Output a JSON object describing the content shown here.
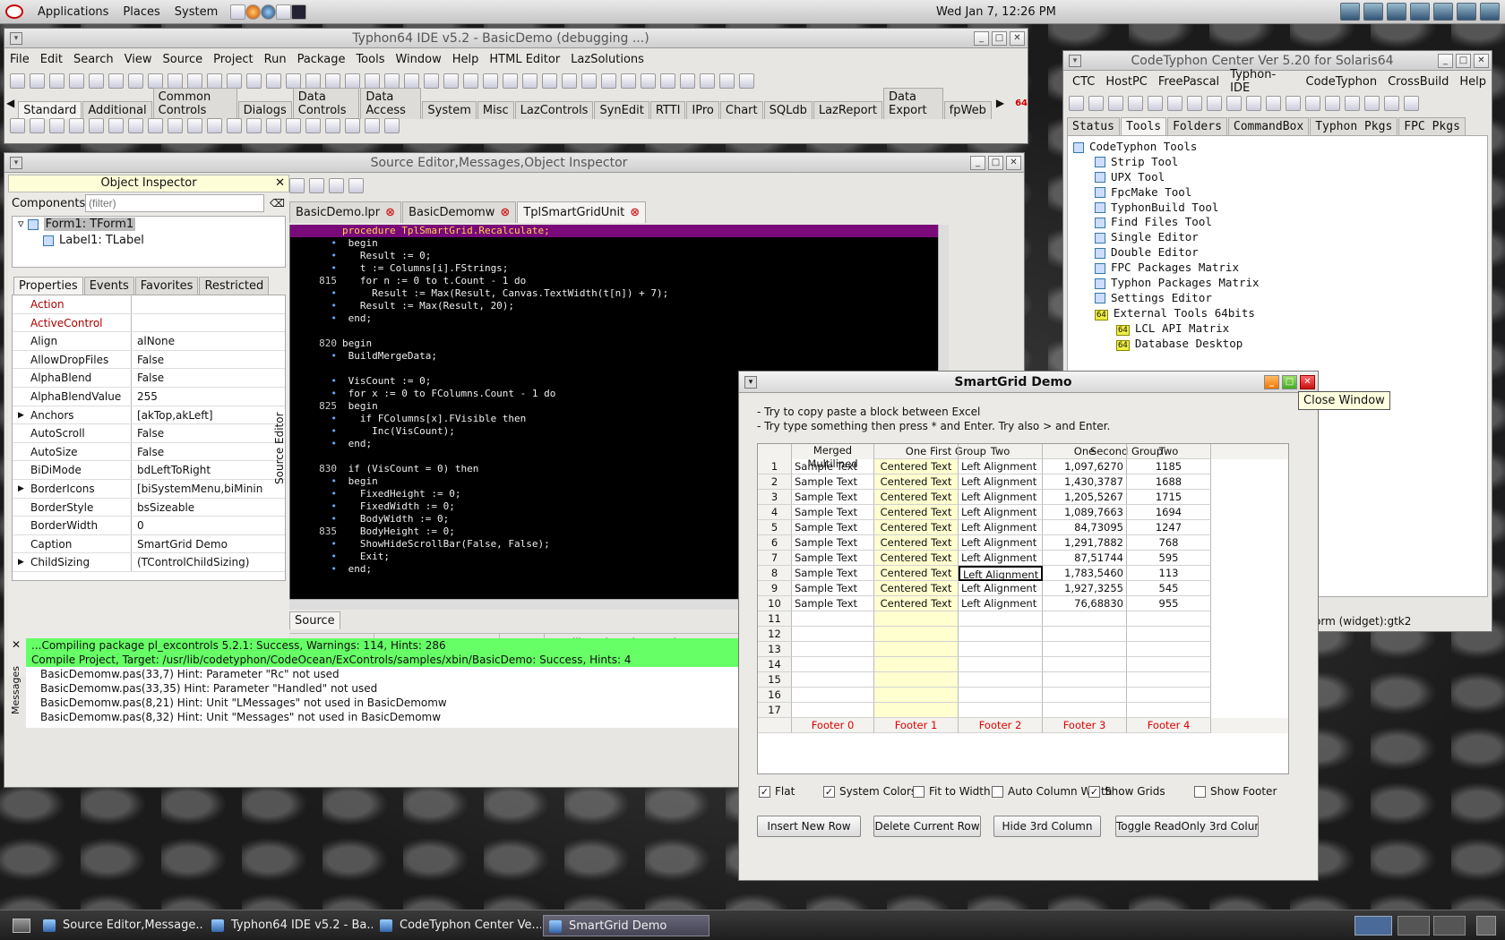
{
  "topbar": {
    "menus": [
      "Applications",
      "Places",
      "System"
    ],
    "clock": "Wed Jan  7, 12:26 PM"
  },
  "ide": {
    "title": "Typhon64 IDE v5.2 - BasicDemo (debugging ...)",
    "menus": [
      "File",
      "Edit",
      "Search",
      "View",
      "Source",
      "Project",
      "Run",
      "Package",
      "Tools",
      "Window",
      "Help",
      "HTML Editor",
      "LazSolutions"
    ],
    "palette_tabs": [
      "Standard",
      "Additional",
      "Common Controls",
      "Dialogs",
      "Data Controls",
      "Data Access",
      "System",
      "Misc",
      "LazControls",
      "SynEdit",
      "RTTI",
      "IPro",
      "Chart",
      "SQLdb",
      "LazReport",
      "Data Export",
      "fpWeb"
    ],
    "badge": "64"
  },
  "source_window": {
    "title": "Source Editor,Messages,Object Inspector"
  },
  "object_inspector": {
    "title": "Object Inspector",
    "components_label": "Components",
    "filter_placeholder": "(filter)",
    "tree": [
      "Form1: TForm1",
      "Label1: TLabel"
    ],
    "tabs": [
      "Properties",
      "Events",
      "Favorites",
      "Restricted"
    ],
    "props": [
      {
        "k": "Action",
        "v": "",
        "red": true
      },
      {
        "k": "ActiveControl",
        "v": "",
        "red": true
      },
      {
        "k": "Align",
        "v": "alNone"
      },
      {
        "k": "AllowDropFiles",
        "v": "False"
      },
      {
        "k": "AlphaBlend",
        "v": "False"
      },
      {
        "k": "AlphaBlendValue",
        "v": "255"
      },
      {
        "k": "Anchors",
        "v": "[akTop,akLeft]",
        "exp": true
      },
      {
        "k": "AutoScroll",
        "v": "False"
      },
      {
        "k": "AutoSize",
        "v": "False"
      },
      {
        "k": "BiDiMode",
        "v": "bdLeftToRight"
      },
      {
        "k": "BorderIcons",
        "v": "[biSystemMenu,biMinin",
        "exp": true
      },
      {
        "k": "BorderStyle",
        "v": "bsSizeable"
      },
      {
        "k": "BorderWidth",
        "v": "0"
      },
      {
        "k": "Caption",
        "v": "SmartGrid Demo"
      },
      {
        "k": "ChildSizing",
        "v": "(TControlChildSizing)",
        "exp": true
      }
    ]
  },
  "editor": {
    "side_label": "Source Editor",
    "tabs": [
      "BasicDemo.lpr",
      "BasicDemomw",
      "TplSmartGridUnit"
    ],
    "lines": [
      {
        "g": "",
        "t": "procedure TplSmartGrid.Recalculate;",
        "hl": true
      },
      {
        "g": "•",
        "t": " begin"
      },
      {
        "g": "•",
        "t": "   Result := 0;"
      },
      {
        "g": "•",
        "t": "   t := Columns[i].FStrings;"
      },
      {
        "g": "815",
        "t": "   for n := 0 to t.Count - 1 do"
      },
      {
        "g": "•",
        "t": "     Result := Max(Result, Canvas.TextWidth(t[n]) + 7);"
      },
      {
        "g": "•",
        "t": "   Result := Max(Result, 20);"
      },
      {
        "g": "•",
        "t": " end;"
      },
      {
        "g": "",
        "t": ""
      },
      {
        "g": "820",
        "t": "begin"
      },
      {
        "g": "•",
        "t": " BuildMergeData;"
      },
      {
        "g": "",
        "t": ""
      },
      {
        "g": "•",
        "t": " VisCount := 0;"
      },
      {
        "g": "•",
        "t": " for x := 0 to FColumns.Count - 1 do"
      },
      {
        "g": "825",
        "t": " begin"
      },
      {
        "g": "•",
        "t": "   if FColumns[x].FVisible then"
      },
      {
        "g": "•",
        "t": "     Inc(VisCount);"
      },
      {
        "g": "•",
        "t": " end;"
      },
      {
        "g": "",
        "t": ""
      },
      {
        "g": "830",
        "t": " if (VisCount = 0) then"
      },
      {
        "g": "•",
        "t": " begin"
      },
      {
        "g": "•",
        "t": "   FixedHeight := 0;"
      },
      {
        "g": "•",
        "t": "   FixedWidth := 0;"
      },
      {
        "g": "•",
        "t": "   BodyWidth := 0;"
      },
      {
        "g": "835",
        "t": "   BodyHeight := 0;"
      },
      {
        "g": "•",
        "t": "   ShowHideScrollBar(False, False);"
      },
      {
        "g": "•",
        "t": "   Exit;"
      },
      {
        "g": "•",
        "t": " end;"
      }
    ],
    "source_tab": "Source",
    "status_pos": "820:  10",
    "status_mode": "INS",
    "status_path": "/usr/lib/codetyphon/typhon/co"
  },
  "messages": {
    "side_label": "Messages",
    "lines": [
      {
        "t": "...Compiling package pl_excontrols 5.2.1: Success, Warnings: 114, Hints: 286",
        "green": true
      },
      {
        "t": "Compile Project, Target: /usr/lib/codetyphon/CodeOcean/ExControls/samples/xbin/BasicDemo: Success, Hints: 4",
        "green": true
      },
      {
        "t": "BasicDemomw.pas(33,7) Hint: Parameter \"Rc\" not used"
      },
      {
        "t": "BasicDemomw.pas(33,35) Hint: Parameter \"Handled\" not used"
      },
      {
        "t": "BasicDemomw.pas(8,21) Hint: Unit \"LMessages\" not used in BasicDemomw"
      },
      {
        "t": "BasicDemomw.pas(8,32) Hint: Unit \"Messages\" not used in BasicDemomw"
      }
    ]
  },
  "center": {
    "title": "CodeTyphon Center Ver 5.20 for Solaris64",
    "menus": [
      "CTC",
      "HostPC",
      "FreePascal",
      "Typhon-IDE",
      "CodeTyphon",
      "CrossBuild",
      "Help"
    ],
    "tabs": [
      "Status",
      "Tools",
      "Folders",
      "CommandBox",
      "Typhon Pkgs",
      "FPC Pkgs"
    ],
    "tree": [
      {
        "t": "CodeTyphon Tools",
        "lvl": 0
      },
      {
        "t": "Strip Tool",
        "lvl": 1
      },
      {
        "t": "UPX Tool",
        "lvl": 1
      },
      {
        "t": "FpcMake Tool",
        "lvl": 1
      },
      {
        "t": "TyphonBuild Tool",
        "lvl": 1
      },
      {
        "t": "Find Files Tool",
        "lvl": 1
      },
      {
        "t": "Single Editor",
        "lvl": 1
      },
      {
        "t": "Double Editor",
        "lvl": 1
      },
      {
        "t": "FPC Packages Matrix",
        "lvl": 1
      },
      {
        "t": "Typhon Packages Matrix",
        "lvl": 1
      },
      {
        "t": "Settings Editor",
        "lvl": 1
      },
      {
        "t": "External Tools 64bits",
        "lvl": 1,
        "b": "64"
      },
      {
        "t": "LCL API Matrix",
        "lvl": 2,
        "b": "64"
      },
      {
        "t": "Database Desktop",
        "lvl": 2,
        "b": "64"
      }
    ],
    "status": "orm (widget):gtk2"
  },
  "smartgrid": {
    "title": "SmartGrid Demo",
    "tooltip": "Close Window",
    "hint1": "- Try to copy paste a block between Excel",
    "hint2": "- Try type something then press * and Enter. Try also > and Enter.",
    "header": {
      "merged": "Merged\nMultilined",
      "g1": "First Group",
      "g2": "Second Group",
      "one": "One",
      "two": "Two"
    },
    "rows": [
      {
        "n": "1",
        "a": "Sample Text",
        "b": "Centered Text",
        "c": "Left Alignment",
        "d": "1,097,6270",
        "e": "1185"
      },
      {
        "n": "2",
        "a": "Sample Text",
        "b": "Centered Text",
        "c": "Left Alignment",
        "d": "1,430,3787",
        "e": "1688"
      },
      {
        "n": "3",
        "a": "Sample Text",
        "b": "Centered Text",
        "c": "Left Alignment",
        "d": "1,205,5267",
        "e": "1715"
      },
      {
        "n": "4",
        "a": "Sample Text",
        "b": "Centered Text",
        "c": "Left Alignment",
        "d": "1,089,7663",
        "e": "1694"
      },
      {
        "n": "5",
        "a": "Sample Text",
        "b": "Centered Text",
        "c": "Left Alignment",
        "d": "84,73095",
        "e": "1247"
      },
      {
        "n": "6",
        "a": "Sample Text",
        "b": "Centered Text",
        "c": "Left Alignment",
        "d": "1,291,7882",
        "e": "768"
      },
      {
        "n": "7",
        "a": "Sample Text",
        "b": "Centered Text",
        "c": "Left Alignment",
        "d": "87,51744",
        "e": "595"
      },
      {
        "n": "8",
        "a": "Sample Text",
        "b": "Centered Text",
        "c": "Left Alignment",
        "d": "1,783,5460",
        "e": "113"
      },
      {
        "n": "9",
        "a": "Sample Text",
        "b": "Centered Text",
        "c": "Left Alignment",
        "d": "1,927,3255",
        "e": "545"
      },
      {
        "n": "10",
        "a": "Sample Text",
        "b": "Centered Text",
        "c": "Left Alignment",
        "d": "76,68830",
        "e": "955"
      },
      {
        "n": "11"
      },
      {
        "n": "12"
      },
      {
        "n": "13"
      },
      {
        "n": "14"
      },
      {
        "n": "15"
      },
      {
        "n": "16"
      },
      {
        "n": "17"
      }
    ],
    "footers": [
      "Footer 0",
      "Footer 1",
      "Footer 2",
      "Footer 3",
      "Footer 4"
    ],
    "checks": [
      {
        "l": "Flat",
        "on": true
      },
      {
        "l": "System Colors",
        "on": true
      },
      {
        "l": "Fit to Width",
        "on": false
      },
      {
        "l": "Auto Column Width",
        "on": false
      },
      {
        "l": "Show Grids",
        "on": true
      },
      {
        "l": "Show Footer",
        "on": false
      }
    ],
    "buttons": [
      "Insert New Row",
      "Delete Current Row",
      "Hide 3rd Column",
      "Toggle ReadOnly 3rd Colum"
    ]
  },
  "taskbar": [
    "Source Editor,Message...",
    "Typhon64 IDE v5.2 - Ba...",
    "CodeTyphon Center Ve...",
    "SmartGrid Demo"
  ]
}
